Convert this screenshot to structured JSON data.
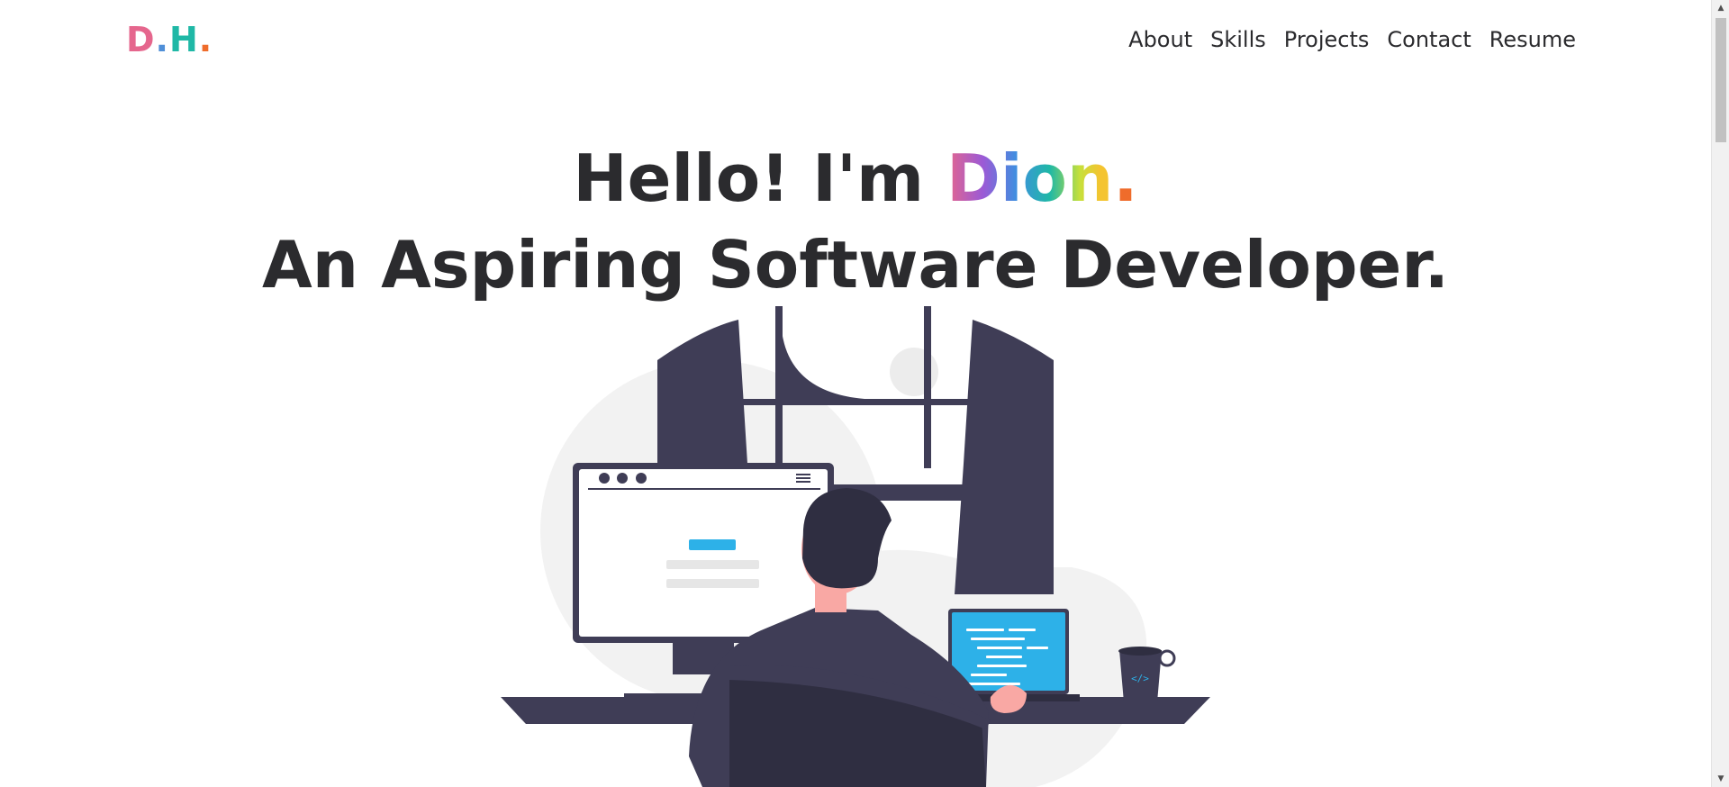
{
  "nav": {
    "logo": {
      "d": "D",
      "dot1": ".",
      "h": "H",
      "dot2": "."
    },
    "links": [
      "About",
      "Skills",
      "Projects",
      "Contact",
      "Resume"
    ]
  },
  "hero": {
    "greeting": "Hello! I'm ",
    "name": "Dion",
    "name_dot": ".",
    "tagline": "An Aspiring Software Developer."
  },
  "illustration": {
    "icon": "developer-at-desk-illustration",
    "mug_code": "</>"
  },
  "colors": {
    "dark": "#3f3d56",
    "accent_blue": "#2db1e8",
    "skin": "#f9a8a4",
    "blob": "#f2f2f2"
  }
}
